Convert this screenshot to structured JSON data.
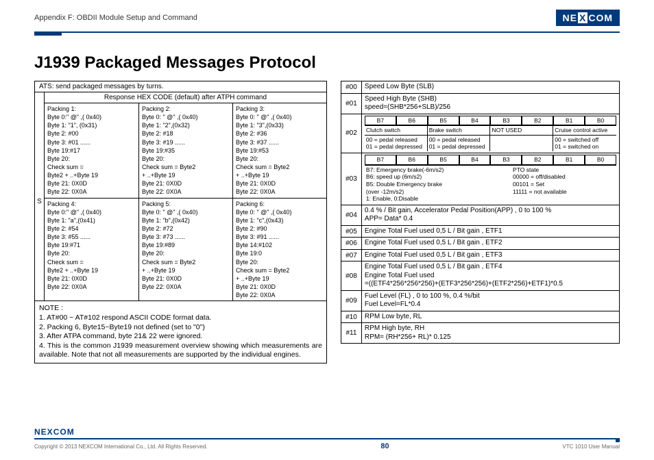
{
  "header": {
    "title": "Appendix F: OBDII Module Setup and Command",
    "logo1": "NE",
    "logoX": "X",
    "logo2": "COM"
  },
  "page_title": "J1939 Packaged Messages Protocol",
  "left": {
    "ats": "ATS: send packaged messages by turns.",
    "resp": "Response HEX CODE (default) after ATPH command",
    "s": "S",
    "packs": [
      {
        "t": "Packing 1:",
        "lines": [
          "Byte 0:\" @\" ,( 0x40)",
          "Byte 1: \"1\", (0x31)",
          "Byte 2: #00",
          "Byte 3: #01 ......",
          "Byte 19:#17",
          "Byte 20:",
          "Check sum =",
          "Byte2 + ..+Byte 19",
          "Byte 21: 0X0D",
          "Byte 22: 0X0A"
        ]
      },
      {
        "t": "Packing 2:",
        "lines": [
          "Byte 0: \" @\" ,( 0x40)",
          "Byte 1: \"2\",(0x32)",
          "Byte 2: #18",
          "Byte 3: #19 ......",
          "Byte 19:#35",
          "Byte 20:",
          "Check sum = Byte2",
          "+ ..+Byte 19",
          "Byte 21: 0X0D",
          "Byte 22: 0X0A"
        ]
      },
      {
        "t": "Packing 3:",
        "lines": [
          "Byte 0: \" @\" ,( 0x40)",
          "Byte 1: \"3\",(0x33)",
          "Byte 2: #36",
          "Byte 3: #37 ......",
          "Byte 19:#53",
          "Byte 20:",
          "Check sum = Byte2",
          "+ ..+Byte 19",
          "Byte 21: 0X0D",
          "Byte 22: 0X0A"
        ]
      },
      {
        "t": "Packing 4:",
        "lines": [
          "Byte 0:\" @\" ,( 0x40)",
          "Byte 1: \"a\",(0x41)",
          "Byte 2: #54",
          "Byte 3: #55 ......",
          "Byte 19:#71",
          "Byte 20:",
          "Check sum =",
          "Byte2 + ..+Byte 19",
          "Byte 21: 0X0D",
          "Byte 22: 0X0A"
        ]
      },
      {
        "t": "Packing 5:",
        "lines": [
          "Byte 0: \" @\" ,( 0x40)",
          "Byte 1: \"b\",(0x42)",
          "Byte 2: #72",
          "Byte 3: #73 ......",
          "Byte 19:#89",
          "Byte 20:",
          "Check sum = Byte2",
          "+ ..+Byte 19",
          "Byte 21: 0X0D",
          "Byte 22: 0X0A"
        ]
      },
      {
        "t": "Packing 6:",
        "lines": [
          "Byte 0: \" @\" ,( 0x40)",
          "Byte 1: \"c\",(0x43)",
          "Byte 2: #90",
          "Byte 3: #91 ......",
          "Byte 14:#102",
          "Byte 19:0",
          "Byte 20:",
          "Check sum = Byte2",
          "+ ..+Byte 19",
          "Byte 21: 0X0D",
          "Byte 22: 0X0A"
        ]
      }
    ],
    "notes": [
      "NOTE :",
      "1. AT#00 ~ AT#102 respond ASCII CODE format data.",
      "2. Packing 6, Byte15~Byte19 not defined (set to \"0\")",
      "3. After ATPA command, byte 21& 22 were ignored.",
      "4. This is the common J1939 measurement overview showing which measurements are available. Note that not all measurements are supported by the individual engines."
    ]
  },
  "right": {
    "rows": [
      {
        "idx": "#00",
        "text": "Speed Low Byte (SLB)"
      },
      {
        "idx": "#01",
        "text": "Speed High Byte (SHB)\nspeed=(SHB*256+SLB)/256"
      },
      {
        "idx": "#02",
        "bits": [
          "B7",
          "B6",
          "B5",
          "B4",
          "B3",
          "B2",
          "B1",
          "B0"
        ],
        "sub1": [
          "Clutch switch",
          "Brake switch",
          "NOT USED",
          "Cruise control active"
        ],
        "sub2": [
          "00 = pedal released\n01 = pedal depressed",
          "00 = pedal released\n01 = pedal depressed",
          "",
          "00 = switched off\n01 = switched on"
        ]
      },
      {
        "idx": "#03",
        "bits": [
          "B7",
          "B6",
          "B5",
          "B4",
          "B3",
          "B2",
          "B1",
          "B0"
        ],
        "desc": [
          "B7: Emergency brake(-6m/s2)\nB6: speed up (6m/s2)\nB5: Double Emergency brake\n(over -12m/s2)\n1: Enable, 0:Disable",
          "PTO state\n00000 = off/disabled\n00101 = Set\n11111 = not available"
        ]
      },
      {
        "idx": "#04",
        "text": "0.4 % / Bit gain, Accelerator Pedal Position(APP) , 0 to 100 %\nAPP= Data* 0.4"
      },
      {
        "idx": "#05",
        "text": "Engine Total Fuel used 0,5 L / Bit gain , ETF1"
      },
      {
        "idx": "#06",
        "text": "Engine Total Fuel used 0,5 L / Bit gain , ETF2"
      },
      {
        "idx": "#07",
        "text": "Engine Total Fuel used 0,5 L / Bit gain , ETF3"
      },
      {
        "idx": "#08",
        "text": "Engine Total Fuel used 0,5 L / Bit gain , ETF4\nEngine Total Fuel used\n=((ETF4*256*256*256)+(ETF3*256*256)+(ETF2*256)+ETF1)*0.5"
      },
      {
        "idx": "#09",
        "text": "Fuel Level (FL) , 0 to 100 %, 0.4 %/bit\nFuel Level=FL*0.4"
      },
      {
        "idx": "#10",
        "text": "RPM Low byte, RL"
      },
      {
        "idx": "#11",
        "text": "RPM High byte, RH\nRPM= (RH*256+ RL)* 0.125"
      }
    ]
  },
  "footer": {
    "copyright": "Copyright © 2013 NEXCOM International Co., Ltd. All Rights Reserved.",
    "page": "80",
    "manual": "VTC 1010 User Manual"
  }
}
